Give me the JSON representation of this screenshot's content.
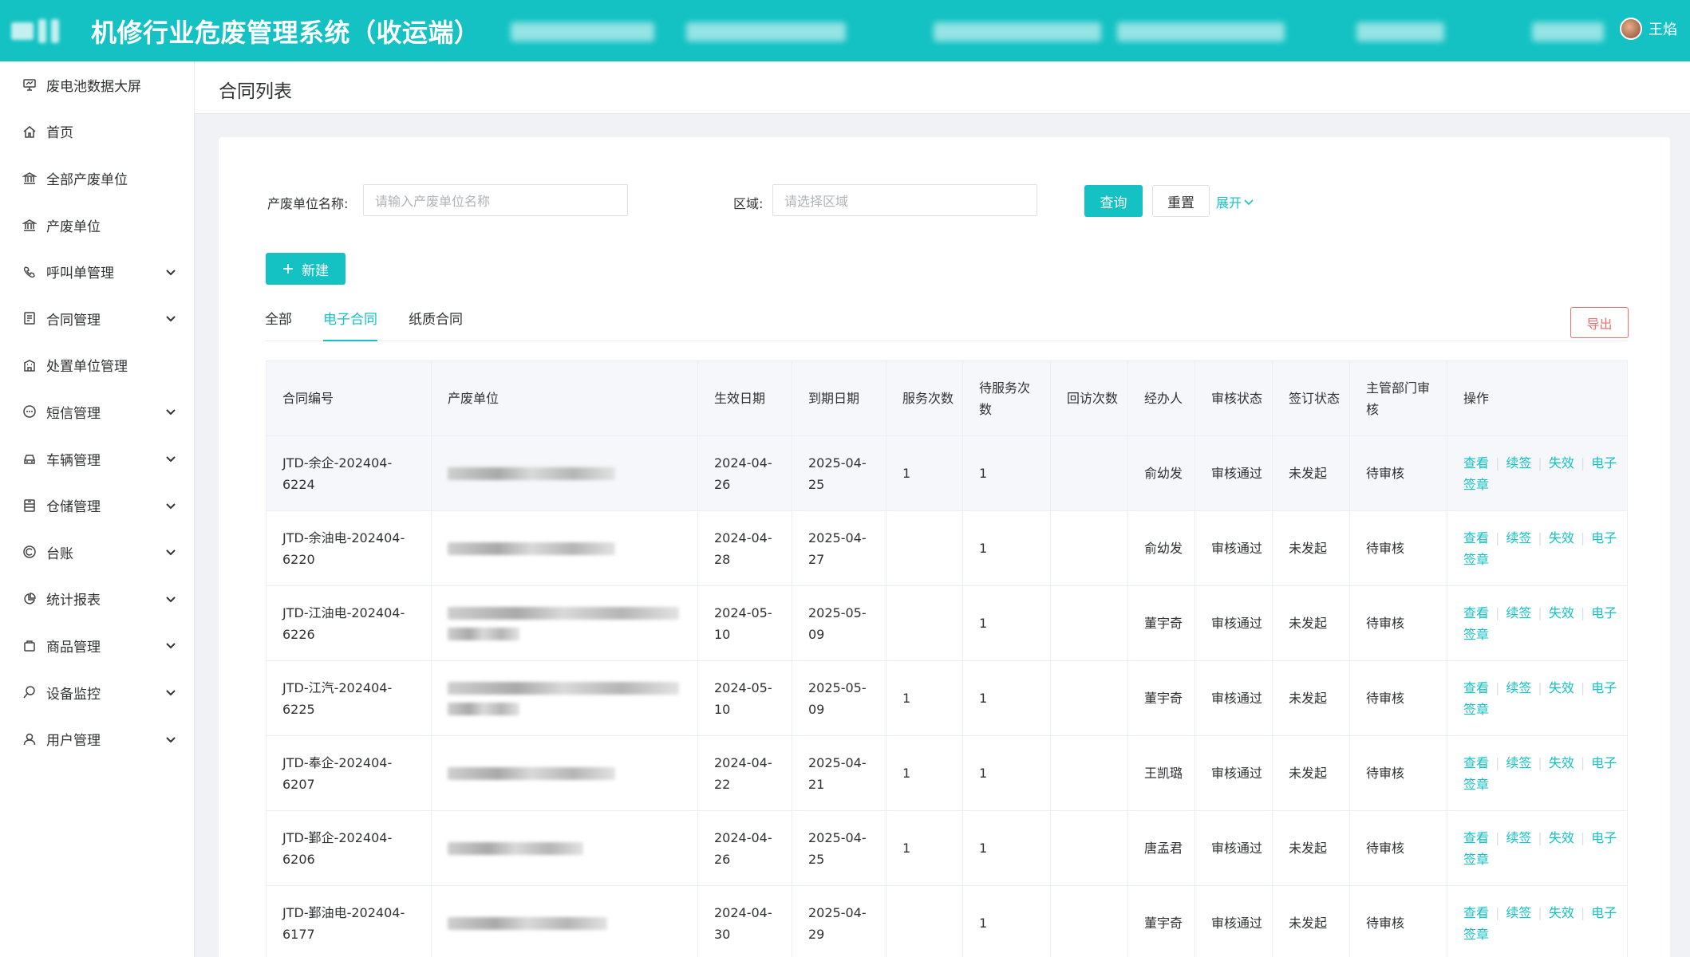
{
  "header": {
    "title": "机修行业危废管理系统（收运端）",
    "user_name": "王焰"
  },
  "sidebar": {
    "items": [
      {
        "label": "废电池数据大屏",
        "icon": "monitor-icon",
        "expandable": false
      },
      {
        "label": "首页",
        "icon": "home-icon",
        "expandable": false
      },
      {
        "label": "全部产废单位",
        "icon": "bank-icon",
        "expandable": false
      },
      {
        "label": "产废单位",
        "icon": "bank-icon",
        "expandable": false
      },
      {
        "label": "呼叫单管理",
        "icon": "phone-icon",
        "expandable": true
      },
      {
        "label": "合同管理",
        "icon": "contract-icon",
        "expandable": true
      },
      {
        "label": "处置单位管理",
        "icon": "building-icon",
        "expandable": false
      },
      {
        "label": "短信管理",
        "icon": "message-icon",
        "expandable": true
      },
      {
        "label": "车辆管理",
        "icon": "car-icon",
        "expandable": true
      },
      {
        "label": "仓储管理",
        "icon": "warehouse-icon",
        "expandable": true
      },
      {
        "label": "台账",
        "icon": "ledger-icon",
        "expandable": true
      },
      {
        "label": "统计报表",
        "icon": "chart-pie-icon",
        "expandable": true
      },
      {
        "label": "商品管理",
        "icon": "bag-icon",
        "expandable": true
      },
      {
        "label": "设备监控",
        "icon": "monitor-search-icon",
        "expandable": true
      },
      {
        "label": "用户管理",
        "icon": "user-icon",
        "expandable": true
      }
    ]
  },
  "page": {
    "title": "合同列表"
  },
  "filters": {
    "unit_label": "产废单位名称:",
    "unit_placeholder": "请输入产废单位名称",
    "area_label": "区域:",
    "area_placeholder": "请选择区域",
    "query": "查询",
    "reset": "重置",
    "expand": "展开"
  },
  "actions": {
    "new": "新建",
    "export": "导出"
  },
  "tabs": [
    {
      "label": "全部",
      "active": false
    },
    {
      "label": "电子合同",
      "active": true
    },
    {
      "label": "纸质合同",
      "active": false
    }
  ],
  "table": {
    "columns": [
      "合同编号",
      "产废单位",
      "生效日期",
      "到期日期",
      "服务次数",
      "待服务次数",
      "回访次数",
      "经办人",
      "审核状态",
      "签订状态",
      "主管部门审核",
      "操作"
    ],
    "op_labels": {
      "view": "查看",
      "renew": "续签",
      "invalid": "失效",
      "esign": "电子签章"
    },
    "rows": [
      {
        "contract_no": "JTD-余企-202404-6224",
        "start": "2024-04-26",
        "end": "2025-04-25",
        "service": "1",
        "pending": "1",
        "visit": "",
        "handler": "俞幼发",
        "audit": "审核通过",
        "sign": "未发起",
        "dept": "待审核"
      },
      {
        "contract_no": "JTD-余油电-202404-6220",
        "start": "2024-04-28",
        "end": "2025-04-27",
        "service": "",
        "pending": "1",
        "visit": "",
        "handler": "俞幼发",
        "audit": "审核通过",
        "sign": "未发起",
        "dept": "待审核"
      },
      {
        "contract_no": "JTD-江油电-202404-6226",
        "start": "2024-05-10",
        "end": "2025-05-09",
        "service": "",
        "pending": "1",
        "visit": "",
        "handler": "董宇奇",
        "audit": "审核通过",
        "sign": "未发起",
        "dept": "待审核"
      },
      {
        "contract_no": "JTD-江汽-202404-6225",
        "start": "2024-05-10",
        "end": "2025-05-09",
        "service": "1",
        "pending": "1",
        "visit": "",
        "handler": "董宇奇",
        "audit": "审核通过",
        "sign": "未发起",
        "dept": "待审核"
      },
      {
        "contract_no": "JTD-奉企-202404-6207",
        "start": "2024-04-22",
        "end": "2025-04-21",
        "service": "1",
        "pending": "1",
        "visit": "",
        "handler": "王凯璐",
        "audit": "审核通过",
        "sign": "未发起",
        "dept": "待审核"
      },
      {
        "contract_no": "JTD-鄞企-202404-6206",
        "start": "2024-04-26",
        "end": "2025-04-25",
        "service": "1",
        "pending": "1",
        "visit": "",
        "handler": "唐孟君",
        "audit": "审核通过",
        "sign": "未发起",
        "dept": "待审核"
      },
      {
        "contract_no": "JTD-鄞油电-202404-6177",
        "start": "2024-04-30",
        "end": "2025-04-29",
        "service": "",
        "pending": "1",
        "visit": "",
        "handler": "董宇奇",
        "audit": "审核通过",
        "sign": "未发起",
        "dept": "待审核"
      }
    ]
  },
  "colors": {
    "primary": "#14c2c3",
    "danger": "#f56c6c",
    "sidebar_bg": "#ffffff",
    "page_bg": "#f0f2f5"
  }
}
